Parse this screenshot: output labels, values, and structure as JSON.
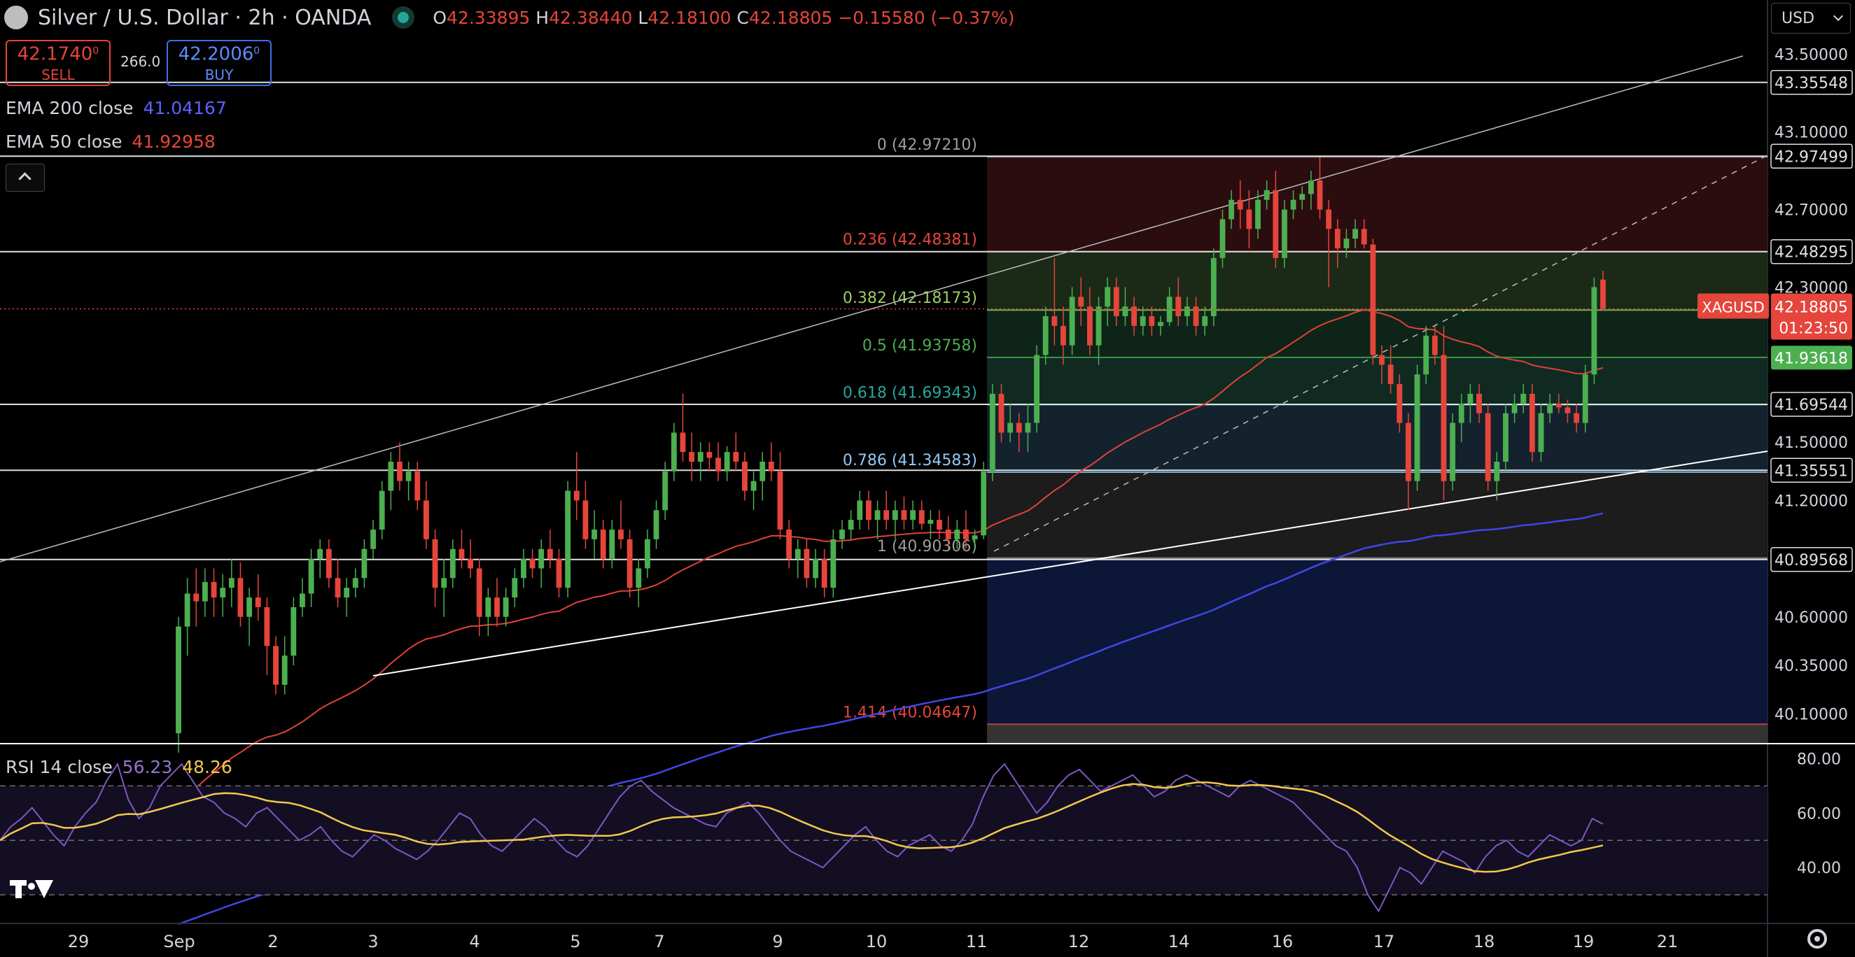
{
  "header": {
    "symbol": "Silver / U.S. Dollar · 2h · OANDA",
    "ohlc": {
      "o": "42.33895",
      "h": "42.38440",
      "l": "42.18100",
      "c": "42.18805",
      "chg": "−0.15580 (−0.37%)"
    },
    "sell_price": "42.1740",
    "sell_sup": "0",
    "sell_label": "SELL",
    "spread": "266.0",
    "buy_price": "42.2006",
    "buy_sup": "0",
    "buy_label": "BUY",
    "currency": "USD"
  },
  "indicators": {
    "ema200": {
      "label": "EMA 200 close",
      "value": "41.04167",
      "color": "#3f47e6"
    },
    "ema50": {
      "label": "EMA 50 close",
      "value": "41.92958",
      "color": "#e0413b"
    },
    "rsi": {
      "label": "RSI 14 close",
      "value": "56.23",
      "ma_value": "48.26",
      "color": "#7e57c2",
      "ma_color": "#f2c94c"
    }
  },
  "colors": {
    "up": "#4caf50",
    "down": "#e5453b",
    "bg": "#000000",
    "grid_line": "#e0e0e0"
  },
  "chart_data": [
    {
      "type": "candlestick",
      "title": "Silver / U.S. Dollar · 2h · OANDA",
      "ylim": [
        39.95,
        43.6
      ],
      "y_ticks": [
        "43.50000",
        "43.10000",
        "42.70000",
        "42.30000",
        "41.50000",
        "41.20000",
        "40.60000",
        "40.35000",
        "40.10000"
      ],
      "x_ticks": [
        "29",
        "Sep",
        "2",
        "3",
        "4",
        "5",
        "7",
        "9",
        "10",
        "11",
        "12",
        "14",
        "16",
        "17",
        "18",
        "19",
        "21"
      ],
      "horizontal_levels": [
        "43.35548",
        "42.97499",
        "42.48295",
        "41.69544",
        "41.35551",
        "40.89568"
      ],
      "price_tag": {
        "symbol": "XAGUSD",
        "value": "42.18805",
        "countdown": "01:23:50",
        "color": "#e5453b"
      },
      "ema50_tag": {
        "value": "41.93618",
        "color": "#4caf50"
      },
      "fib_levels": [
        {
          "label": "0 (42.97210)",
          "value": 42.9721,
          "color": "#9e9e9e"
        },
        {
          "label": "0.236 (42.48381)",
          "value": 42.48381,
          "color": "#e5453b"
        },
        {
          "label": "0.382 (42.18173)",
          "value": 42.18173,
          "color": "#9ccc65"
        },
        {
          "label": "0.5 (41.93758)",
          "value": 41.93758,
          "color": "#4caf50"
        },
        {
          "label": "0.618 (41.69343)",
          "value": 41.69343,
          "color": "#26a69a"
        },
        {
          "label": "0.786 (41.34583)",
          "value": 41.34583,
          "color": "#90caf9"
        },
        {
          "label": "1 (40.90306)",
          "value": 40.90306,
          "color": "#9e9e9e"
        },
        {
          "label": "1.414 (40.04647)",
          "value": 40.04647,
          "color": "#e5453b"
        }
      ],
      "candles": [
        [
          40.0,
          40.6,
          39.9,
          40.55
        ],
        [
          40.55,
          40.8,
          40.4,
          40.72
        ],
        [
          40.72,
          40.85,
          40.55,
          40.68
        ],
        [
          40.68,
          40.85,
          40.6,
          40.78
        ],
        [
          40.78,
          40.85,
          40.6,
          40.7
        ],
        [
          40.7,
          40.82,
          40.6,
          40.75
        ],
        [
          40.75,
          40.9,
          40.65,
          40.8
        ],
        [
          40.8,
          40.88,
          40.55,
          40.6
        ],
        [
          40.6,
          40.75,
          40.45,
          40.7
        ],
        [
          40.7,
          40.82,
          40.58,
          40.65
        ],
        [
          40.65,
          40.7,
          40.3,
          40.45
        ],
        [
          40.45,
          40.5,
          40.2,
          40.25
        ],
        [
          40.25,
          40.5,
          40.2,
          40.4
        ],
        [
          40.4,
          40.7,
          40.35,
          40.65
        ],
        [
          40.65,
          40.8,
          40.6,
          40.72
        ],
        [
          40.72,
          40.95,
          40.65,
          40.9
        ],
        [
          40.9,
          41.0,
          40.8,
          40.95
        ],
        [
          40.95,
          41.0,
          40.75,
          40.8
        ],
        [
          40.8,
          40.9,
          40.65,
          40.7
        ],
        [
          40.7,
          40.8,
          40.6,
          40.75
        ],
        [
          40.75,
          40.85,
          40.7,
          40.8
        ],
        [
          40.8,
          41.0,
          40.75,
          40.95
        ],
        [
          40.95,
          41.1,
          40.9,
          41.05
        ],
        [
          41.05,
          41.3,
          41.0,
          41.25
        ],
        [
          41.25,
          41.45,
          41.15,
          41.4
        ],
        [
          41.4,
          41.5,
          41.25,
          41.3
        ],
        [
          41.3,
          41.4,
          41.2,
          41.35
        ],
        [
          41.35,
          41.4,
          41.15,
          41.2
        ],
        [
          41.2,
          41.3,
          40.95,
          41.0
        ],
        [
          41.0,
          41.05,
          40.65,
          40.75
        ],
        [
          40.75,
          40.9,
          40.6,
          40.8
        ],
        [
          40.8,
          41.0,
          40.75,
          40.95
        ],
        [
          40.95,
          41.05,
          40.85,
          40.9
        ],
        [
          40.9,
          41.0,
          40.8,
          40.85
        ],
        [
          40.85,
          40.9,
          40.5,
          40.6
        ],
        [
          40.6,
          40.75,
          40.5,
          40.7
        ],
        [
          40.7,
          40.8,
          40.55,
          40.6
        ],
        [
          40.6,
          40.75,
          40.55,
          40.7
        ],
        [
          40.7,
          40.85,
          40.65,
          40.8
        ],
        [
          40.8,
          40.95,
          40.75,
          40.9
        ],
        [
          40.9,
          40.95,
          40.8,
          40.85
        ],
        [
          40.85,
          41.0,
          40.75,
          40.95
        ],
        [
          40.95,
          41.05,
          40.85,
          40.9
        ],
        [
          40.9,
          40.95,
          40.7,
          40.75
        ],
        [
          40.75,
          41.3,
          40.7,
          41.25
        ],
        [
          41.25,
          41.45,
          41.1,
          41.2
        ],
        [
          41.2,
          41.3,
          40.95,
          41.0
        ],
        [
          41.0,
          41.15,
          40.9,
          41.05
        ],
        [
          41.05,
          41.1,
          40.85,
          40.9
        ],
        [
          40.9,
          41.1,
          40.85,
          41.05
        ],
        [
          41.05,
          41.2,
          40.95,
          41.0
        ],
        [
          41.0,
          41.05,
          40.7,
          40.75
        ],
        [
          40.75,
          40.9,
          40.65,
          40.85
        ],
        [
          40.85,
          41.05,
          40.8,
          41.0
        ],
        [
          41.0,
          41.2,
          40.95,
          41.15
        ],
        [
          41.15,
          41.4,
          41.1,
          41.35
        ],
        [
          41.35,
          41.6,
          41.3,
          41.55
        ],
        [
          41.55,
          41.75,
          41.4,
          41.45
        ],
        [
          41.45,
          41.55,
          41.3,
          41.4
        ],
        [
          41.4,
          41.5,
          41.3,
          41.45
        ],
        [
          41.45,
          41.5,
          41.35,
          41.42
        ],
        [
          41.42,
          41.5,
          41.3,
          41.35
        ],
        [
          41.35,
          41.48,
          41.3,
          41.45
        ],
        [
          41.45,
          41.55,
          41.35,
          41.4
        ],
        [
          41.4,
          41.45,
          41.2,
          41.25
        ],
        [
          41.25,
          41.35,
          41.15,
          41.3
        ],
        [
          41.3,
          41.45,
          41.2,
          41.4
        ],
        [
          41.4,
          41.5,
          41.3,
          41.35
        ],
        [
          41.35,
          41.45,
          41.0,
          41.05
        ],
        [
          41.05,
          41.1,
          40.85,
          40.9
        ],
        [
          40.9,
          41.0,
          40.8,
          40.95
        ],
        [
          40.95,
          41.0,
          40.75,
          40.8
        ],
        [
          40.8,
          40.95,
          40.75,
          40.9
        ],
        [
          40.9,
          40.95,
          40.7,
          40.75
        ],
        [
          40.75,
          41.05,
          40.7,
          41.0
        ],
        [
          41.0,
          41.1,
          40.95,
          41.05
        ],
        [
          41.05,
          41.15,
          41.0,
          41.1
        ],
        [
          41.1,
          41.25,
          41.05,
          41.2
        ],
        [
          41.2,
          41.25,
          41.05,
          41.1
        ],
        [
          41.1,
          41.2,
          41.0,
          41.15
        ],
        [
          41.15,
          41.25,
          41.05,
          41.1
        ],
        [
          41.1,
          41.2,
          41.0,
          41.15
        ],
        [
          41.15,
          41.22,
          41.05,
          41.1
        ],
        [
          41.1,
          41.2,
          41.05,
          41.15
        ],
        [
          41.15,
          41.2,
          41.05,
          41.08
        ],
        [
          41.08,
          41.15,
          41.0,
          41.1
        ],
        [
          41.1,
          41.15,
          41.0,
          41.05
        ],
        [
          41.05,
          41.12,
          40.95,
          41.0
        ],
        [
          41.0,
          41.1,
          40.95,
          41.05
        ],
        [
          41.05,
          41.15,
          40.95,
          41.0
        ],
        [
          41.0,
          41.05,
          40.95,
          41.02
        ],
        [
          41.02,
          41.4,
          41.0,
          41.35
        ],
        [
          41.35,
          41.8,
          41.3,
          41.75
        ],
        [
          41.75,
          41.8,
          41.5,
          41.55
        ],
        [
          41.55,
          41.7,
          41.5,
          41.6
        ],
        [
          41.6,
          41.65,
          41.45,
          41.55
        ],
        [
          41.55,
          41.7,
          41.45,
          41.6
        ],
        [
          41.6,
          42.0,
          41.55,
          41.95
        ],
        [
          41.95,
          42.2,
          41.9,
          42.15
        ],
        [
          42.15,
          42.45,
          42.0,
          42.1
        ],
        [
          42.1,
          42.2,
          41.9,
          42.0
        ],
        [
          42.0,
          42.3,
          41.95,
          42.25
        ],
        [
          42.25,
          42.35,
          42.1,
          42.2
        ],
        [
          42.2,
          42.3,
          41.95,
          42.0
        ],
        [
          42.0,
          42.25,
          41.9,
          42.2
        ],
        [
          42.2,
          42.35,
          42.1,
          42.3
        ],
        [
          42.3,
          42.35,
          42.1,
          42.15
        ],
        [
          42.15,
          42.3,
          42.1,
          42.2
        ],
        [
          42.2,
          42.25,
          42.05,
          42.1
        ],
        [
          42.1,
          42.2,
          42.05,
          42.15
        ],
        [
          42.15,
          42.2,
          42.05,
          42.1
        ],
        [
          42.1,
          42.15,
          42.05,
          42.12
        ],
        [
          42.12,
          42.3,
          42.1,
          42.25
        ],
        [
          42.25,
          42.35,
          42.1,
          42.15
        ],
        [
          42.15,
          42.25,
          42.1,
          42.2
        ],
        [
          42.2,
          42.25,
          42.05,
          42.1
        ],
        [
          42.1,
          42.2,
          42.05,
          42.15
        ],
        [
          42.15,
          42.5,
          42.1,
          42.45
        ],
        [
          42.45,
          42.7,
          42.4,
          42.65
        ],
        [
          42.65,
          42.8,
          42.6,
          42.75
        ],
        [
          42.75,
          42.85,
          42.6,
          42.7
        ],
        [
          42.7,
          42.8,
          42.5,
          42.6
        ],
        [
          42.6,
          42.8,
          42.55,
          42.75
        ],
        [
          42.75,
          42.85,
          42.7,
          42.8
        ],
        [
          42.8,
          42.9,
          42.4,
          42.45
        ],
        [
          42.45,
          42.75,
          42.4,
          42.7
        ],
        [
          42.7,
          42.8,
          42.65,
          42.75
        ],
        [
          42.75,
          42.82,
          42.7,
          42.78
        ],
        [
          42.78,
          42.9,
          42.7,
          42.85
        ],
        [
          42.85,
          42.97,
          42.65,
          42.7
        ],
        [
          42.7,
          42.75,
          42.3,
          42.6
        ],
        [
          42.6,
          42.65,
          42.4,
          42.5
        ],
        [
          42.5,
          42.6,
          42.45,
          42.55
        ],
        [
          42.55,
          42.65,
          42.5,
          42.6
        ],
        [
          42.6,
          42.65,
          42.5,
          42.52
        ],
        [
          42.52,
          42.55,
          41.9,
          41.95
        ],
        [
          41.95,
          42.0,
          41.8,
          41.9
        ],
        [
          41.9,
          42.0,
          41.75,
          41.8
        ],
        [
          41.8,
          41.85,
          41.55,
          41.6
        ],
        [
          41.6,
          41.65,
          41.15,
          41.3
        ],
        [
          41.3,
          41.9,
          41.25,
          41.85
        ],
        [
          41.85,
          42.1,
          41.8,
          42.05
        ],
        [
          42.05,
          42.1,
          41.9,
          41.95
        ],
        [
          41.95,
          42.1,
          41.2,
          41.3
        ],
        [
          41.3,
          41.65,
          41.25,
          41.6
        ],
        [
          41.6,
          41.75,
          41.5,
          41.7
        ],
        [
          41.7,
          41.8,
          41.6,
          41.75
        ],
        [
          41.75,
          41.8,
          41.6,
          41.65
        ],
        [
          41.65,
          41.7,
          41.25,
          41.3
        ],
        [
          41.3,
          41.45,
          41.2,
          41.4
        ],
        [
          41.4,
          41.7,
          41.35,
          41.65
        ],
        [
          41.65,
          41.75,
          41.6,
          41.7
        ],
        [
          41.7,
          41.8,
          41.65,
          41.75
        ],
        [
          41.75,
          41.8,
          41.4,
          41.45
        ],
        [
          41.45,
          41.7,
          41.4,
          41.65
        ],
        [
          41.65,
          41.75,
          41.6,
          41.7
        ],
        [
          41.7,
          41.75,
          41.65,
          41.68
        ],
        [
          41.68,
          41.72,
          41.6,
          41.65
        ],
        [
          41.65,
          41.7,
          41.55,
          41.6
        ],
        [
          41.6,
          41.9,
          41.55,
          41.85
        ],
        [
          41.85,
          42.35,
          41.8,
          42.3
        ],
        [
          42.33895,
          42.3844,
          42.181,
          42.18805
        ]
      ],
      "rsi": {
        "ylim": [
          20,
          85
        ],
        "ticks": [
          "80.00",
          "60.00",
          "40.00"
        ],
        "values": [
          50,
          55,
          58,
          62,
          57,
          52,
          48,
          55,
          60,
          64,
          72,
          78,
          65,
          58,
          62,
          70,
          74,
          78,
          72,
          66,
          64,
          60,
          58,
          55,
          60,
          62,
          58,
          54,
          50,
          52,
          55,
          50,
          46,
          44,
          48,
          52,
          50,
          47,
          45,
          43,
          46,
          50,
          55,
          60,
          58,
          52,
          48,
          46,
          50,
          54,
          58,
          55,
          50,
          46,
          44,
          48,
          54,
          60,
          66,
          70,
          72,
          68,
          65,
          62,
          60,
          58,
          56,
          55,
          60,
          62,
          64,
          60,
          55,
          50,
          46,
          44,
          42,
          40,
          44,
          48,
          52,
          55,
          50,
          46,
          44,
          48,
          50,
          52,
          48,
          46,
          50,
          56,
          66,
          74,
          78,
          72,
          66,
          60,
          64,
          70,
          74,
          76,
          72,
          68,
          70,
          72,
          74,
          70,
          66,
          68,
          72,
          74,
          72,
          70,
          68,
          66,
          70,
          72,
          70,
          68,
          66,
          64,
          60,
          56,
          52,
          48,
          46,
          40,
          30,
          24,
          32,
          40,
          38,
          34,
          40,
          46,
          44,
          42,
          38,
          44,
          48,
          50,
          46,
          44,
          48,
          52,
          50,
          48,
          50,
          58,
          56
        ]
      }
    }
  ]
}
